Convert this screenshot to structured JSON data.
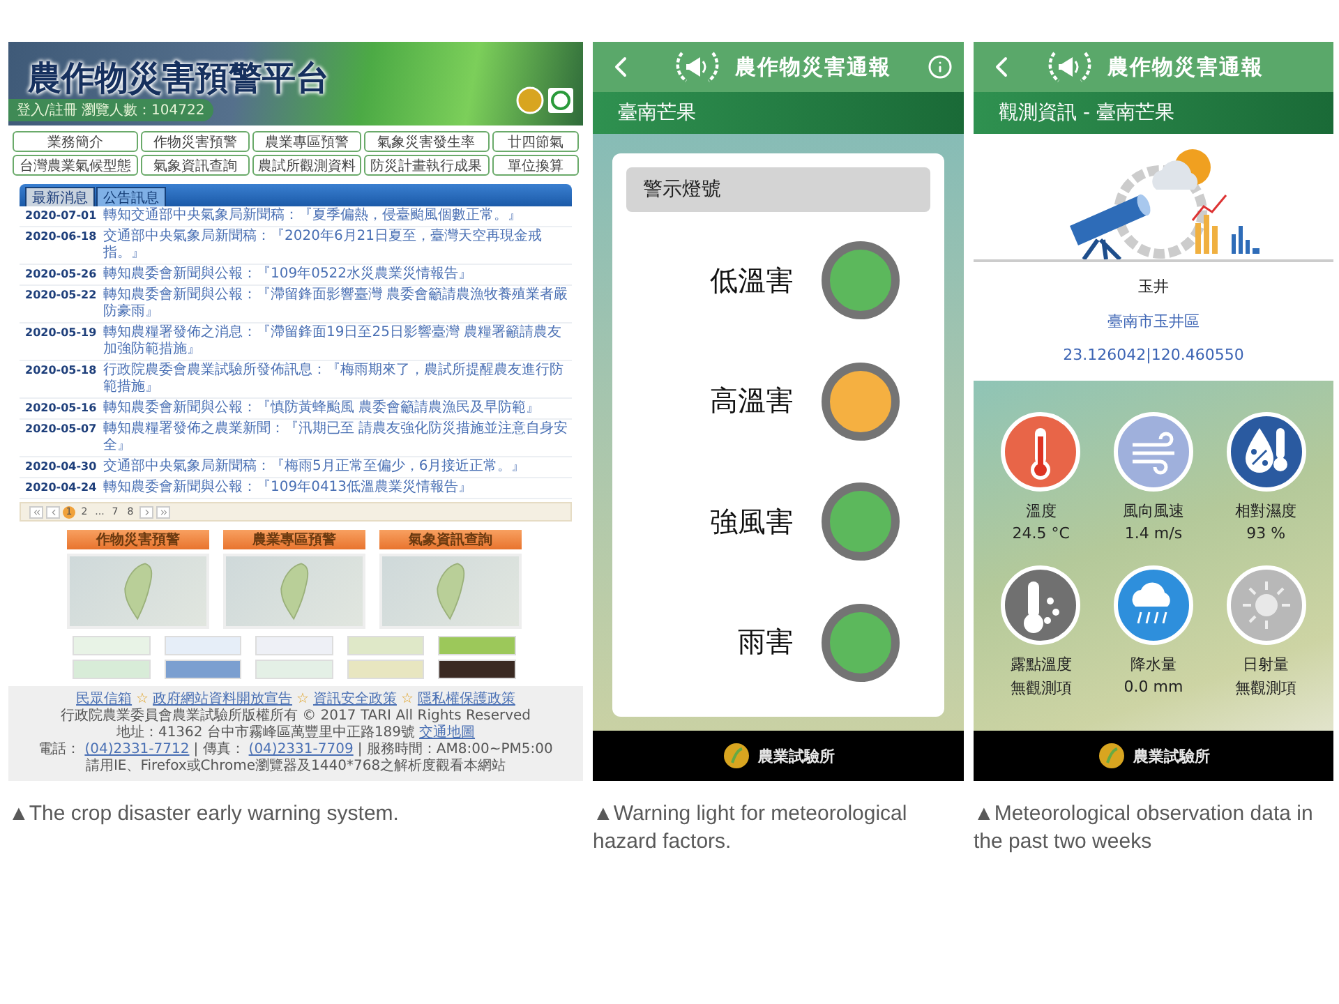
{
  "web": {
    "title": "農作物災害預警平台",
    "login_text": "登入/註冊 瀏覽人數：104722",
    "nav": [
      "業務簡介",
      "作物災害預警",
      "農業專區預警",
      "氣象災害發生率",
      "廿四節氣",
      "台灣農業氣候型態",
      "氣象資訊查詢",
      "農試所觀測資料",
      "防災計畫執行成果",
      "單位換算"
    ],
    "tabs": [
      {
        "label": "最新消息",
        "selected": true
      },
      {
        "label": "公告訊息",
        "selected": false
      }
    ],
    "news": [
      {
        "date": "2020-07-01",
        "text": "轉知交通部中央氣象局新聞稿：『夏季偏熱，侵臺颱風個數正常。』"
      },
      {
        "date": "2020-06-18",
        "text": "交通部中央氣象局新聞稿：『2020年6月21日夏至，臺灣天空再現金戒指。』"
      },
      {
        "date": "2020-05-26",
        "text": "轉知農委會新聞與公報：『109年0522水災農業災情報告』"
      },
      {
        "date": "2020-05-22",
        "text": "轉知農委會新聞與公報：『滯留鋒面影響臺灣 農委會籲請農漁牧養殖業者嚴防豪雨』"
      },
      {
        "date": "2020-05-19",
        "text": "轉知農糧署發佈之消息：『滯留鋒面19日至25日影響臺灣 農糧署籲請農友加強防範措施』"
      },
      {
        "date": "2020-05-18",
        "text": "行政院農委會農業試驗所發佈訊息：『梅雨期來了，農試所提醒農友進行防範措施』"
      },
      {
        "date": "2020-05-16",
        "text": "轉知農委會新聞與公報：『慎防黃蜂颱風 農委會籲請農漁民及早防範』"
      },
      {
        "date": "2020-05-07",
        "text": "轉知農糧署發佈之農業新聞：『汛期已至 請農友強化防災措施並注意自身安全』"
      },
      {
        "date": "2020-04-30",
        "text": "交通部中央氣象局新聞稿：『梅雨5月正常至偏少，6月接近正常。』"
      },
      {
        "date": "2020-04-24",
        "text": "轉知農委會新聞與公報：『109年0413低溫農業災情報告』"
      }
    ],
    "pages": [
      {
        "label": "1",
        "selected": true
      },
      {
        "label": "2",
        "selected": false
      },
      {
        "label": "...",
        "selected": false
      },
      {
        "label": "7",
        "selected": false
      },
      {
        "label": "8",
        "selected": false
      }
    ],
    "map_panels": [
      {
        "title": "作物災害預警"
      },
      {
        "title": "農業專區預警"
      },
      {
        "title": "氣象資訊查詢"
      }
    ],
    "footer": {
      "links": [
        {
          "kind": "link",
          "text": "民眾信箱"
        },
        {
          "kind": "separator",
          "text": "☆"
        },
        {
          "kind": "link",
          "text": "政府網站資料開放宣告"
        },
        {
          "kind": "separator",
          "text": "☆"
        },
        {
          "kind": "link",
          "text": "資訊安全政策"
        },
        {
          "kind": "separator",
          "text": "☆"
        },
        {
          "kind": "link",
          "text": "隱私權保護政策"
        }
      ],
      "copyright": "行政院農業委員會農業試驗所版權所有 © 2017 TARI All Rights Reserved",
      "address": [
        {
          "kind": "text",
          "text": "地址：41362 台中市霧峰區萬豐里中正路189號"
        },
        {
          "kind": "link",
          "text": "交通地圖"
        }
      ],
      "contact": [
        {
          "kind": "text",
          "text": "電話："
        },
        {
          "kind": "link",
          "text": "(04)2331-7712"
        },
        {
          "kind": "text",
          "text": "| 傳真："
        },
        {
          "kind": "link",
          "text": "(04)2331-7709"
        },
        {
          "kind": "text",
          "text": "| 服務時間：AM8:00~PM5:00"
        }
      ],
      "note": "請用IE、Firefox或Chrome瀏覽器及1440*768之解析度觀看本網站"
    }
  },
  "alert_app": {
    "app_title": "農作物災害通報",
    "crop": "臺南芒果",
    "card_title": "警示燈號",
    "lights": [
      {
        "label": "低溫害",
        "color": "#5cb85c"
      },
      {
        "label": "高溫害",
        "color": "#f5b041"
      },
      {
        "label": "強風害",
        "color": "#5cb85c"
      },
      {
        "label": "雨害",
        "color": "#5cb85c"
      }
    ],
    "footer_name": "農業試驗所"
  },
  "obs_app": {
    "app_title": "農作物災害通報",
    "subtitle": "觀測資訊 - 臺南芒果",
    "station": "玉井",
    "district": "臺南市玉井區",
    "coords": "23.126042|120.460550",
    "readings": [
      {
        "kind": "temperature",
        "label": "溫度",
        "value": "24.5 °C"
      },
      {
        "kind": "wind",
        "label": "風向風速",
        "value": "1.4 m/s"
      },
      {
        "kind": "humidity",
        "label": "相對濕度",
        "value": "93 %"
      },
      {
        "kind": "dewpoint",
        "label": "露點溫度",
        "value": "無觀測項"
      },
      {
        "kind": "rain",
        "label": "降水量",
        "value": "0.0 mm"
      },
      {
        "kind": "sun",
        "label": "日射量",
        "value": "無觀測項"
      }
    ],
    "footer_name": "農業試驗所"
  },
  "captions": [
    "▲The crop disaster early warning system.",
    "▲Warning light for meteorological hazard factors.",
    "▲Meteorological observation data in the past two weeks"
  ]
}
